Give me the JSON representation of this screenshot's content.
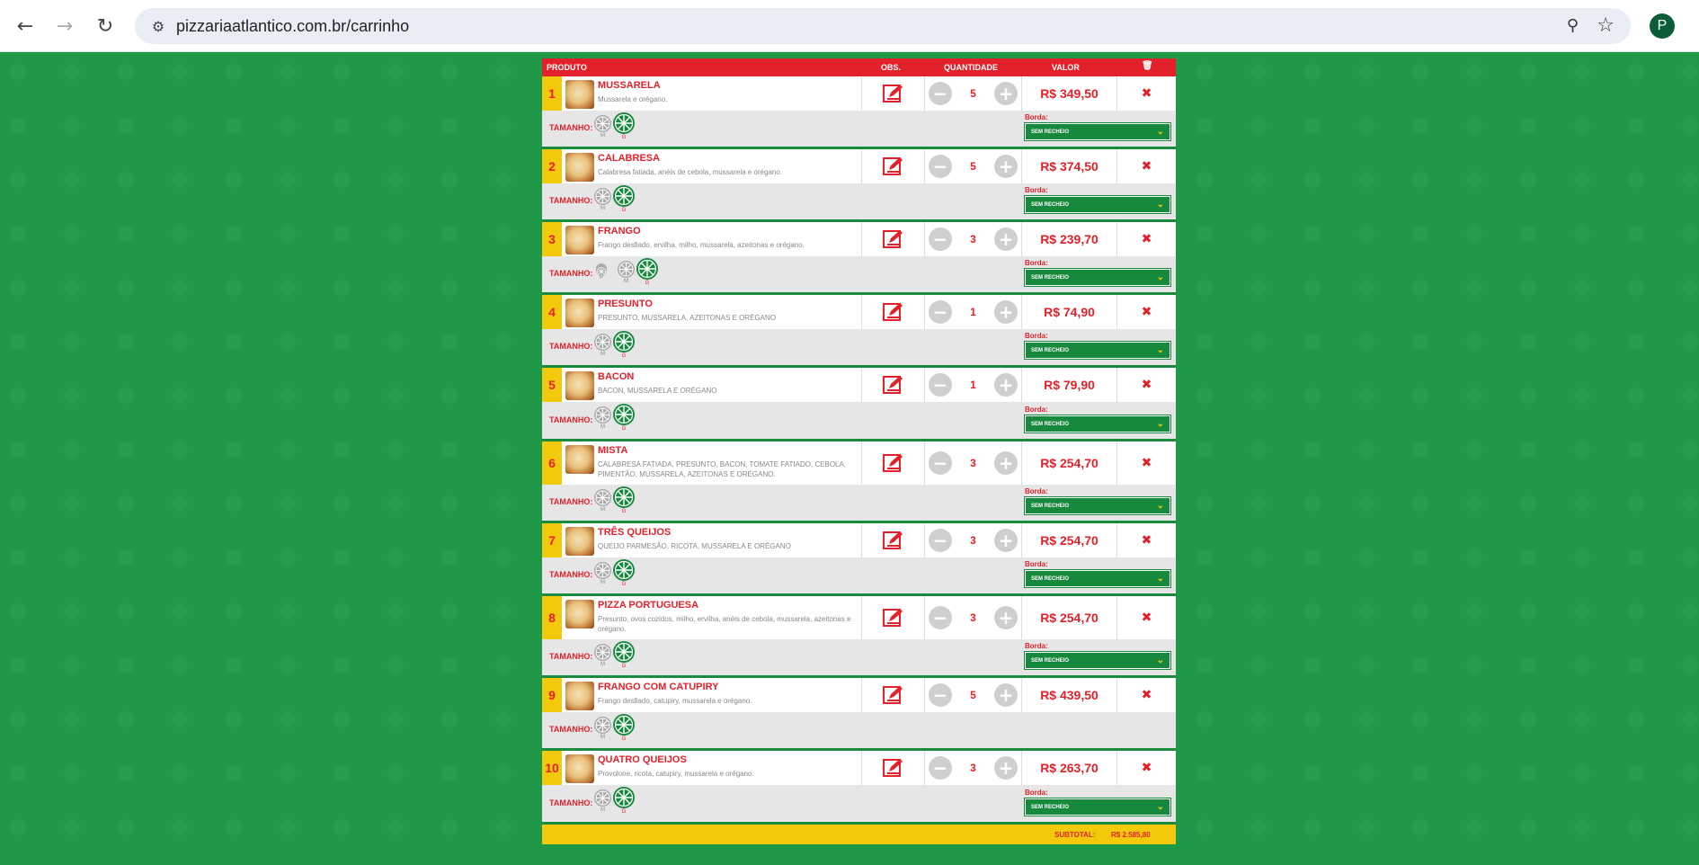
{
  "browser": {
    "url": "pizzariaatlantico.com.br/carrinho",
    "profile_initial": "P",
    "icons": [
      "back-arrow-icon",
      "forward-arrow-icon",
      "reload-icon",
      "site-settings-icon",
      "zoom-icon",
      "bookmark-star-icon"
    ]
  },
  "table": {
    "headers": {
      "product": "PRODUTO",
      "obs": "OBS.",
      "quantity": "QUANTIDADE",
      "value": "VALOR",
      "trash_icon": "trash-icon"
    },
    "size_label": "TAMANHO:",
    "border_label": "Borda:",
    "subtotal_label": "SUBTOTAL:",
    "subtotal_value": "R$ 2.585,80"
  },
  "colors": {
    "green": "#1f9948",
    "red": "#e3212b",
    "yellow": "#f3c90c"
  },
  "items": [
    {
      "num": "1",
      "name": "MUSSARELA",
      "desc": "Mussarela e orégano.",
      "qty": "5",
      "price": "R$ 349,50",
      "sizes": [
        "M",
        "G"
      ],
      "border": "SEM RECHEIO"
    },
    {
      "num": "2",
      "name": "CALABRESA",
      "desc": "Calabresa fatiada, anéis de cebola, mussarela e orégano.",
      "qty": "5",
      "price": "R$ 374,50",
      "sizes": [
        "M",
        "G"
      ],
      "border": "SEM RECHEIO"
    },
    {
      "num": "3",
      "name": "FRANGO",
      "desc": "Frango desfiado, ervilha, milho, mussarela, azeitonas e orégano.",
      "qty": "3",
      "price": "R$ 239,70",
      "sizes": [
        "P",
        "M",
        "G"
      ],
      "border": "SEM RECHEIO"
    },
    {
      "num": "4",
      "name": "PRESUNTO",
      "desc": "PRESUNTO, MUSSARELA, AZEITONAS E ORÉGANO",
      "qty": "1",
      "price": "R$ 74,90",
      "sizes": [
        "M",
        "G"
      ],
      "border": "SEM RECHEIO"
    },
    {
      "num": "5",
      "name": "BACON",
      "desc": "BACON, MUSSARELA E ORÉGANO",
      "qty": "1",
      "price": "R$ 79,90",
      "sizes": [
        "M",
        "G"
      ],
      "border": "SEM RECHEIO"
    },
    {
      "num": "6",
      "name": "MISTA",
      "desc": "CALABRESA FATIADA, PRESUNTO, BACON, TOMATE FATIADO, CEBOLA, PIMENTÃO, MUSSARELA, AZEITONAS E ORÉGANO.",
      "qty": "3",
      "price": "R$ 254,70",
      "sizes": [
        "M",
        "G"
      ],
      "border": "SEM RECHEIO"
    },
    {
      "num": "7",
      "name": "TRÊS QUEIJOS",
      "desc": "QUEIJO PARMESÃO, RICOTA, MUSSARELA E ORÉGANO",
      "qty": "3",
      "price": "R$ 254,70",
      "sizes": [
        "M",
        "G"
      ],
      "border": "SEM RECHEIO"
    },
    {
      "num": "8",
      "name": "PIZZA PORTUGUESA",
      "desc": "Presunto, ovos cozidos, milho, ervilha, anéis de cebola, mussarela, azeitonas e orégano.",
      "qty": "3",
      "price": "R$ 254,70",
      "sizes": [
        "M",
        "G"
      ],
      "border": "SEM RECHEIO"
    },
    {
      "num": "9",
      "name": "FRANGO COM CATUPIRY",
      "desc": "Frango desfiado, catupiry, mussarela e orégano.",
      "qty": "5",
      "price": "R$ 439,50",
      "sizes": [
        "M",
        "G"
      ],
      "border": ""
    },
    {
      "num": "10",
      "name": "QUATRO QUEIJOS",
      "desc": "Provolone, ricota, catupiry, mussarela e orégano.",
      "qty": "3",
      "price": "R$ 263,70",
      "sizes": [
        "M",
        "G"
      ],
      "border": "SEM RECHEIO"
    }
  ]
}
